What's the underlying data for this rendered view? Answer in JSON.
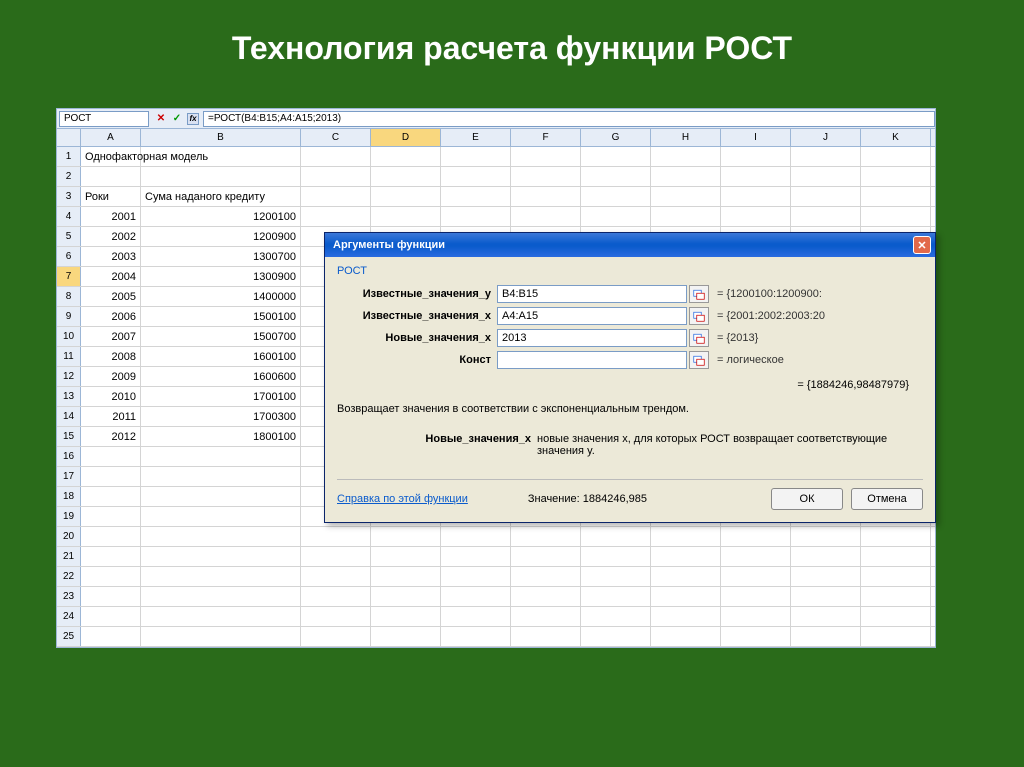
{
  "slide_title": "Технология расчета функции РОСТ",
  "formula_bar": {
    "name_box": "РОСТ",
    "cancel": "✕",
    "confirm": "✓",
    "fx": "fx",
    "formula": "=РОСТ(B4:B15;A4:A15;2013)"
  },
  "columns": [
    "A",
    "B",
    "C",
    "D",
    "E",
    "F",
    "G",
    "H",
    "I",
    "J",
    "K"
  ],
  "selected_col": "D",
  "selected_row": 7,
  "rows": [
    {
      "n": 1,
      "A": "Однофакторная модель",
      "B": ""
    },
    {
      "n": 2,
      "A": "",
      "B": ""
    },
    {
      "n": 3,
      "A": "Роки",
      "B": "Сума наданого кредиту"
    },
    {
      "n": 4,
      "A": "2001",
      "B": "1200100"
    },
    {
      "n": 5,
      "A": "2002",
      "B": "1200900"
    },
    {
      "n": 6,
      "A": "2003",
      "B": "1300700"
    },
    {
      "n": 7,
      "A": "2004",
      "B": "1300900"
    },
    {
      "n": 8,
      "A": "2005",
      "B": "1400000"
    },
    {
      "n": 9,
      "A": "2006",
      "B": "1500100"
    },
    {
      "n": 10,
      "A": "2007",
      "B": "1500700"
    },
    {
      "n": 11,
      "A": "2008",
      "B": "1600100"
    },
    {
      "n": 12,
      "A": "2009",
      "B": "1600600"
    },
    {
      "n": 13,
      "A": "2010",
      "B": "1700100"
    },
    {
      "n": 14,
      "A": "2011",
      "B": "1700300"
    },
    {
      "n": 15,
      "A": "2012",
      "B": "1800100"
    },
    {
      "n": 16,
      "A": "",
      "B": ""
    },
    {
      "n": 17,
      "A": "",
      "B": ""
    },
    {
      "n": 18,
      "A": "",
      "B": ""
    },
    {
      "n": 19,
      "A": "",
      "B": ""
    },
    {
      "n": 20,
      "A": "",
      "B": ""
    },
    {
      "n": 21,
      "A": "",
      "B": ""
    },
    {
      "n": 22,
      "A": "",
      "B": ""
    },
    {
      "n": 23,
      "A": "",
      "B": ""
    },
    {
      "n": 24,
      "A": "",
      "B": ""
    },
    {
      "n": 25,
      "A": "",
      "B": ""
    }
  ],
  "dialog": {
    "title": "Аргументы функции",
    "function": "РОСТ",
    "args": [
      {
        "label": "Известные_значения_y",
        "value": "B4:B15",
        "result": "= {1200100:1200900:"
      },
      {
        "label": "Известные_значения_x",
        "value": "A4:A15",
        "result": "= {2001:2002:2003:20"
      },
      {
        "label": "Новые_значения_x",
        "value": "2013",
        "result": "= {2013}"
      },
      {
        "label": "Конст",
        "value": "",
        "result": "=",
        "result_gray": "логическое"
      }
    ],
    "func_result": "= {1884246,98487979}",
    "description": "Возвращает значения в соответствии с экспоненциальным трендом.",
    "arg_desc_label": "Новые_значения_x",
    "arg_desc_text": "новые значения x, для которых РОСТ возвращает соответствующие значения y.",
    "help_link": "Справка по этой функции",
    "result_label": "Значение:",
    "result_value": "1884246,985",
    "ok": "ОК",
    "cancel": "Отмена"
  }
}
